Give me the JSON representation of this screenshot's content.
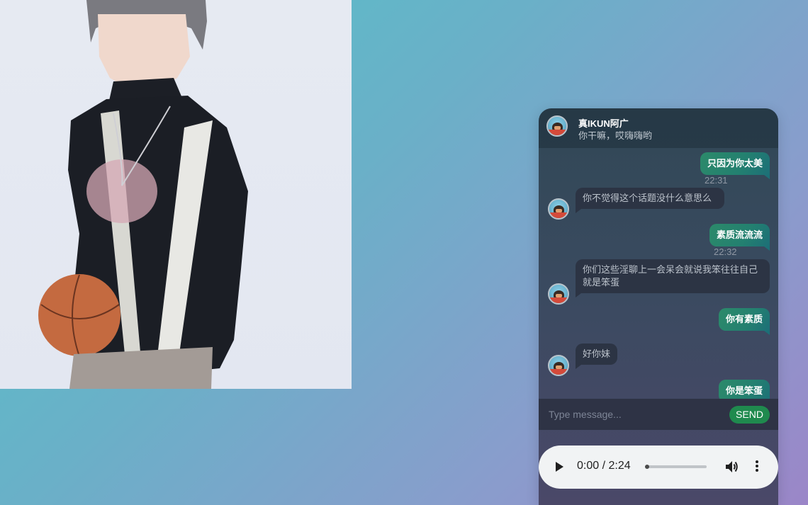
{
  "chat": {
    "header": {
      "name": "真IKUN阿广",
      "status": "你干嘛，哎嗨嗨哟"
    },
    "messages": [
      {
        "direction": "out",
        "text": "只因为你太美",
        "time": "22:31"
      },
      {
        "direction": "in",
        "text": "你不觉得这个话题没什么意思么"
      },
      {
        "direction": "out",
        "text": "素质流流流",
        "time": "22:32"
      },
      {
        "direction": "in",
        "text": "你们这些淫聊上一会呆会就说我笨往往自己就是笨蛋"
      },
      {
        "direction": "out",
        "text": "你有素质"
      },
      {
        "direction": "in",
        "text": "好你妹"
      },
      {
        "direction": "out",
        "text": "你是笨蛋"
      }
    ],
    "composer": {
      "placeholder": "Type message...",
      "send_label": "SEND"
    }
  },
  "audio_player": {
    "time_display": "0:00 / 2:24",
    "progress": 0,
    "play_icon": "play-icon",
    "volume_icon": "volume-icon",
    "more_icon": "more-vertical-icon"
  },
  "colors": {
    "send_button": "#1f8a4e",
    "outgoing_bubble": "#238070",
    "incoming_bubble": "#2c3444"
  }
}
